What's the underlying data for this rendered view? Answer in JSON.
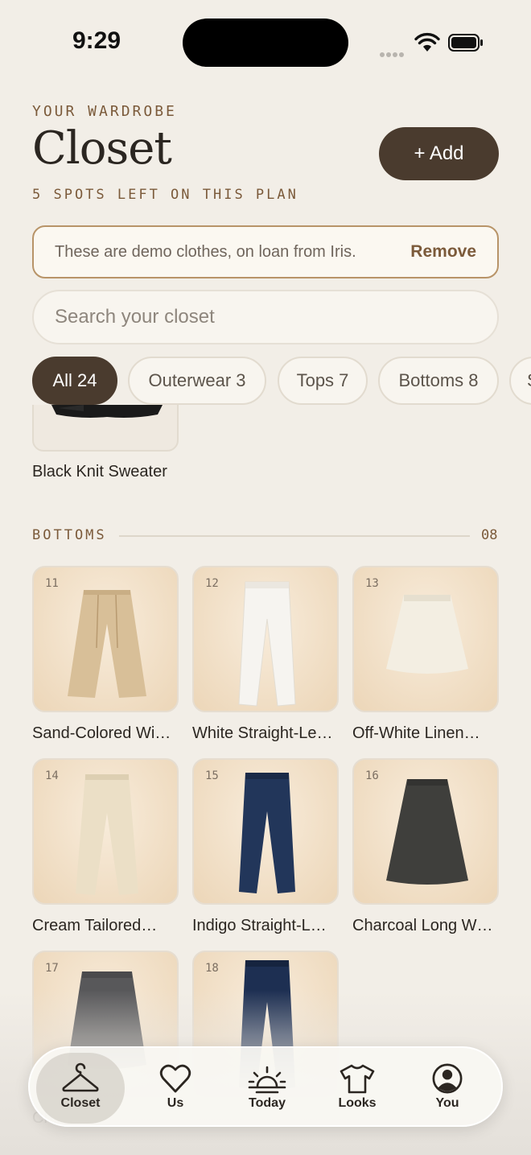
{
  "status_bar": {
    "time": "9:29"
  },
  "header": {
    "eyebrow": "YOUR WARDROBE",
    "title": "Closet",
    "spots_left": "5 SPOTS LEFT ON THIS PLAN",
    "add_label": "+ Add"
  },
  "demo_banner": {
    "text": "These are demo clothes, on loan from Iris.",
    "action": "Remove"
  },
  "search": {
    "placeholder": "Search your closet"
  },
  "filters": [
    {
      "label": "All 24",
      "active": true
    },
    {
      "label": "Outerwear 3",
      "active": false
    },
    {
      "label": "Tops 7",
      "active": false
    },
    {
      "label": "Bottoms 8",
      "active": false
    },
    {
      "label": "S",
      "active": false
    }
  ],
  "tops_tail": {
    "label": "Black Knit Sweater"
  },
  "bottoms": {
    "title": "BOTTOMS",
    "count": "08",
    "items": [
      {
        "num": "11",
        "label": "Sand-Colored Wi…",
        "icon": "wide-trousers-icon",
        "color": "#d8bf98"
      },
      {
        "num": "12",
        "label": "White Straight-Le…",
        "icon": "white-jeans-icon",
        "color": "#f4f2ee"
      },
      {
        "num": "13",
        "label": "Off-White Linen…",
        "icon": "linen-skirt-icon",
        "color": "#f1ebdd"
      },
      {
        "num": "14",
        "label": "Cream Tailored…",
        "icon": "tailored-trousers-icon",
        "color": "#e9dcc2"
      },
      {
        "num": "15",
        "label": "Indigo Straight-L…",
        "icon": "indigo-jeans-icon",
        "color": "#1f3356"
      },
      {
        "num": "16",
        "label": "Charcoal Long W…",
        "icon": "charcoal-skirt-icon",
        "color": "#3f3f3c"
      },
      {
        "num": "17",
        "label": "Ch",
        "icon": "gray-skirt-icon",
        "color": "#58585a"
      },
      {
        "num": "18",
        "label": "",
        "icon": "dark-jeans-icon",
        "color": "#1d2f52"
      }
    ]
  },
  "tab_bar": [
    {
      "label": "Closet",
      "icon": "hanger-icon",
      "active": true
    },
    {
      "label": "Us",
      "icon": "heart-icon",
      "active": false
    },
    {
      "label": "Today",
      "icon": "sunrise-icon",
      "active": false
    },
    {
      "label": "Looks",
      "icon": "tshirt-icon",
      "active": false
    },
    {
      "label": "You",
      "icon": "profile-icon",
      "active": false
    }
  ]
}
